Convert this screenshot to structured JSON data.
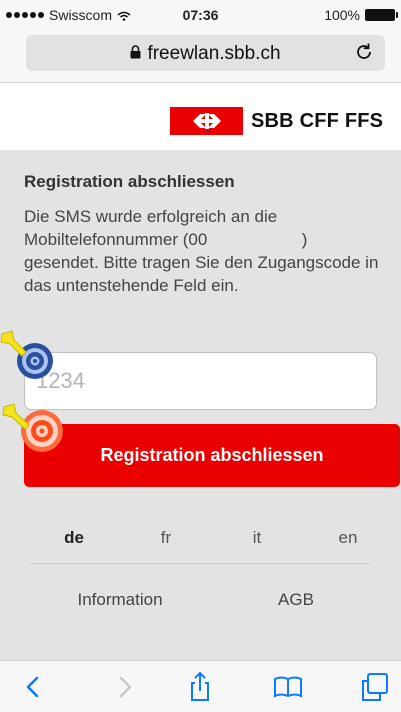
{
  "status_bar": {
    "carrier": "Swisscom",
    "time": "07:36",
    "battery": "100%"
  },
  "browser": {
    "url": "freewlan.sbb.ch"
  },
  "header": {
    "logo_text": "SBB CFF FFS"
  },
  "main": {
    "title": "Registration abschliessen",
    "description": "Die SMS wurde erfolgreich an die Mobiltelefonnummer (00                    ) gesendet. Bitte tragen Sie den Zugangscode in das untenstehende Feld ein.",
    "code_input": {
      "value": "",
      "placeholder": "1234"
    },
    "submit_label": "Registration abschliessen"
  },
  "languages": [
    {
      "code": "de",
      "active": true
    },
    {
      "code": "fr",
      "active": false
    },
    {
      "code": "it",
      "active": false
    },
    {
      "code": "en",
      "active": false
    }
  ],
  "footer_links": [
    "Information",
    "AGB"
  ],
  "colors": {
    "brand_red": "#eb0000",
    "ios_blue": "#0a7aff",
    "page_bg": "#e3e3e3"
  },
  "icons": {
    "lock": "lock-icon",
    "reload": "reload-icon",
    "back": "back-icon",
    "forward": "forward-icon",
    "share": "share-icon",
    "bookmarks": "bookmarks-icon",
    "tabs": "tabs-icon",
    "logo": "sbb-logo-icon",
    "markers": [
      "target-marker-icon",
      "click-marker-icon"
    ]
  }
}
